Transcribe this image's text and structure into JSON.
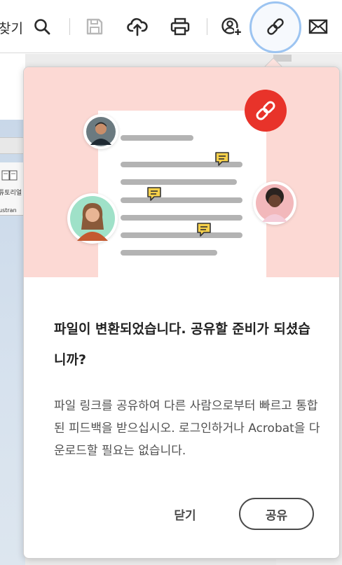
{
  "toolbar": {
    "partial_label": "찾기",
    "icons": [
      "search-icon",
      "save-icon",
      "cloud-upload-icon",
      "print-icon",
      "add-user-icon",
      "link-icon",
      "mail-icon"
    ],
    "active_icon": "link-icon",
    "active_ring_color": "#9cc4f1"
  },
  "background": {
    "tile_label": "튜토리얼",
    "tile_footer": "ustran"
  },
  "popover": {
    "illustration_bg": "#fcd9d4",
    "badge_color": "#e8332a",
    "comment_color": "#f5d04a",
    "title": "파일이 변환되었습니다. 공유할 준비가 되셨습니까?",
    "description": "파일 링크를 공유하여 다른 사람으로부터 빠르고 통합된 피드백을 받으십시오. 로그인하거나 Acrobat을 다운로드할 필요는 없습니다.",
    "close_label": "닫기",
    "share_label": "공유"
  }
}
